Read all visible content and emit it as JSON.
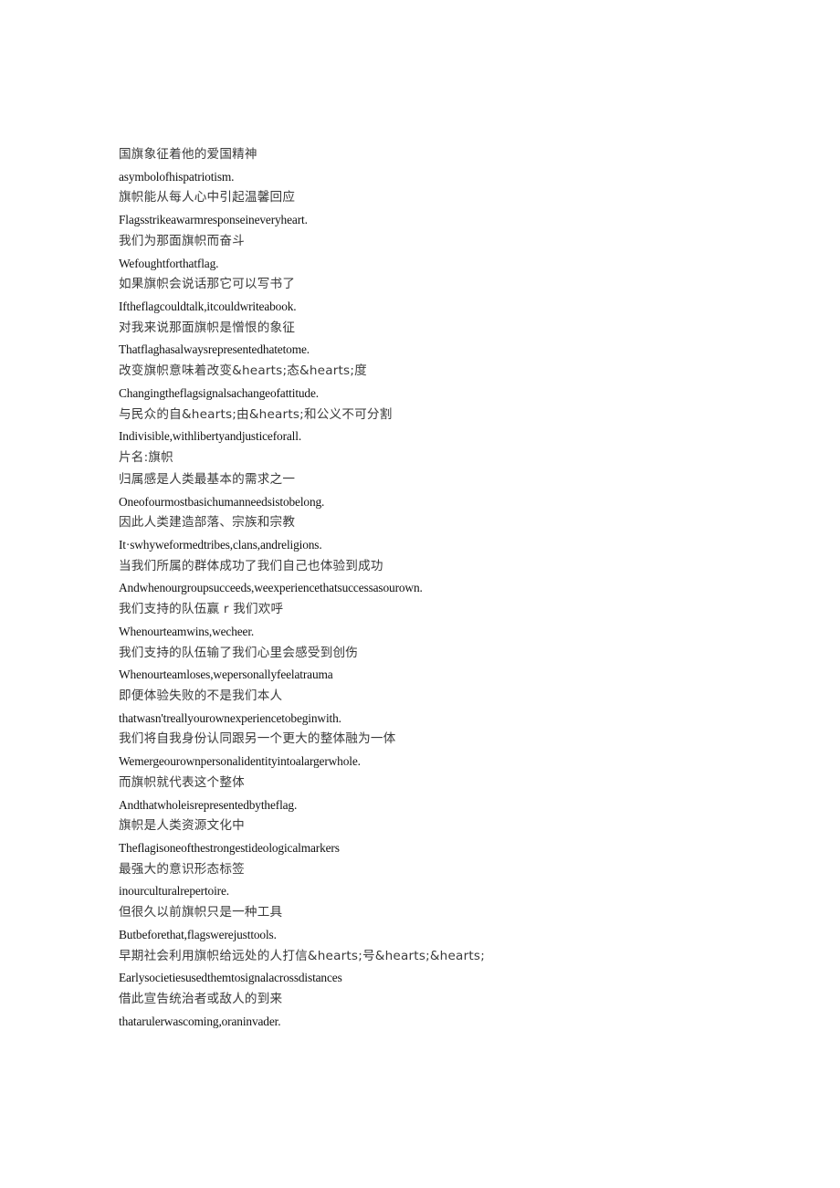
{
  "document": {
    "page_background": "#ffffff",
    "text_color": "#141414",
    "cjk_text_color": "#3a3a3a",
    "lines": [
      {
        "script": "cjk",
        "text": "国旗象征着他的爱国精神"
      },
      {
        "script": "latin",
        "text": "asymbolofhispatriotism."
      },
      {
        "script": "cjk",
        "text": "旗帜能从每人心中引起温馨回应"
      },
      {
        "script": "latin",
        "text": "Flagsstrikeawarmresponseineveryheart."
      },
      {
        "script": "cjk",
        "text": "我们为那面旗帜而奋斗"
      },
      {
        "script": "latin",
        "text": "Wefoughtforthatflag."
      },
      {
        "script": "cjk",
        "text": "如果旗帜会说话那它可以写书了"
      },
      {
        "script": "latin",
        "text": "Iftheflagcouldtalk,itcouldwriteabook."
      },
      {
        "script": "cjk",
        "text": "对我来说那面旗帜是憎恨的象征"
      },
      {
        "script": "latin",
        "text": "Thatflaghasalwaysrepresentedhatetome."
      },
      {
        "script": "cjk",
        "text": "改变旗帜意味着改变&hearts;态&hearts;度"
      },
      {
        "script": "latin",
        "text": "Changingtheflagsignalsachangeofattitude."
      },
      {
        "script": "cjk",
        "text": "与民众的自&hearts;由&hearts;和公义不可分割"
      },
      {
        "script": "latin",
        "text": "Indivisible,withlibertyandjusticeforall."
      },
      {
        "script": "cjk",
        "text": "片名:旗帜"
      },
      {
        "script": "cjk",
        "text": "归属感是人类最基本的需求之一"
      },
      {
        "script": "latin",
        "text": "Oneofourmostbasichumanneedsistobelong."
      },
      {
        "script": "cjk",
        "text": "因此人类建造部落、宗族和宗教"
      },
      {
        "script": "latin",
        "text": "It·swhyweformedtribes,clans,andreligions."
      },
      {
        "script": "cjk",
        "text": "当我们所属的群体成功了我们自己也体验到成功"
      },
      {
        "script": "latin",
        "text": "Andwhenourgroupsucceeds,weexperiencethatsuccessasourown."
      },
      {
        "script": "cjk",
        "text": "我们支持的队伍赢 r 我们欢呼"
      },
      {
        "script": "latin",
        "text": "Whenourteamwins,wecheer."
      },
      {
        "script": "cjk",
        "text": "我们支持的队伍输了我们心里会感受到创伤"
      },
      {
        "script": "latin",
        "text": "Whenourteamloses,wepersonallyfeelatrauma"
      },
      {
        "script": "cjk",
        "text": "即便体验失败的不是我们本人"
      },
      {
        "script": "latin",
        "text": "thatwasn'treallyourownexperiencetobeginwith."
      },
      {
        "script": "cjk",
        "text": "我们将自我身份认同跟另一个更大的整体融为一体"
      },
      {
        "script": "latin",
        "text": "Wemergeourownpersonalidentityintoalargerwhole."
      },
      {
        "script": "cjk",
        "text": "而旗帜就代表这个整体"
      },
      {
        "script": "latin",
        "text": "Andthatwholeisrepresentedbytheflag."
      },
      {
        "script": "cjk",
        "text": "旗帜是人类资源文化中"
      },
      {
        "script": "latin",
        "text": "Theflagisoneofthestrongestideologicalmarkers"
      },
      {
        "script": "cjk",
        "text": "最强大的意识形态标签"
      },
      {
        "script": "latin",
        "text": "inourculturalrepertoire."
      },
      {
        "script": "cjk",
        "text": "但很久以前旗帜只是一种工具"
      },
      {
        "script": "latin",
        "text": "Butbeforethat,flagswerejusttools."
      },
      {
        "script": "cjk",
        "text": "早期社会利用旗帜给远处的人打信&hearts;号&hearts;&hearts;"
      },
      {
        "script": "latin",
        "text": "Earlysocietiesusedthemtosignalacrossdistances"
      },
      {
        "script": "cjk",
        "text": "借此宣告统治者或敌人的到来"
      },
      {
        "script": "latin",
        "text": "thatarulerwascoming,oraninvader."
      }
    ]
  }
}
